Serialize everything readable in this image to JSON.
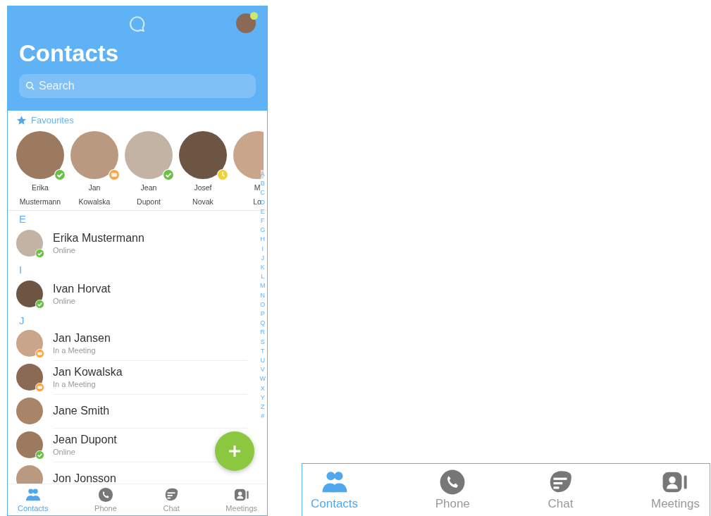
{
  "header": {
    "title": "Contacts",
    "search": {
      "placeholder": "Search"
    }
  },
  "favourites": {
    "label": "Favourites",
    "people": [
      {
        "first": "Erika",
        "last": "Mustermann",
        "kind": "online"
      },
      {
        "first": "Jan",
        "last": "Kowalska",
        "kind": "meeting"
      },
      {
        "first": "Jean",
        "last": "Dupont",
        "kind": "online"
      },
      {
        "first": "Josef",
        "last": "Novak",
        "kind": "away"
      },
      {
        "first": "M",
        "last": "Lo",
        "kind": "plain"
      }
    ]
  },
  "sections": [
    {
      "letter": "E",
      "contacts": [
        {
          "name": "Erika Mustermann",
          "kind": "online",
          "status_text": "Online"
        }
      ]
    },
    {
      "letter": "I",
      "contacts": [
        {
          "name": "Ivan Horvat",
          "kind": "online",
          "status_text": "Online"
        }
      ]
    },
    {
      "letter": "J",
      "contacts": [
        {
          "name": "Jan Jansen",
          "kind": "meeting",
          "status_text": "In a Meeting"
        },
        {
          "name": "Jan Kowalska",
          "kind": "meeting",
          "status_text": "In a Meeting"
        },
        {
          "name": "Jane Smith",
          "kind": "plain"
        },
        {
          "name": "Jean Dupont",
          "kind": "online",
          "status_text": "Online"
        },
        {
          "name": "Jon Jonsson",
          "kind": "plain"
        }
      ]
    }
  ],
  "index_letters": [
    "A",
    "B",
    "C",
    "D",
    "E",
    "F",
    "G",
    "H",
    "I",
    "J",
    "K",
    "L",
    "M",
    "N",
    "O",
    "P",
    "Q",
    "R",
    "S",
    "T",
    "U",
    "V",
    "W",
    "X",
    "Y",
    "Z",
    "#"
  ],
  "tab_bar": [
    {
      "label": "Contacts",
      "selected": true
    },
    {
      "label": "Phone",
      "selected": false
    },
    {
      "label": "Chat",
      "selected": false
    },
    {
      "label": "Meetings",
      "selected": false
    }
  ],
  "enlarged_tab_bar": [
    {
      "label": "Contacts",
      "selected": true
    },
    {
      "label": "Phone",
      "selected": false
    },
    {
      "label": "Chat",
      "selected": false
    },
    {
      "label": "Meetings",
      "selected": false
    }
  ]
}
